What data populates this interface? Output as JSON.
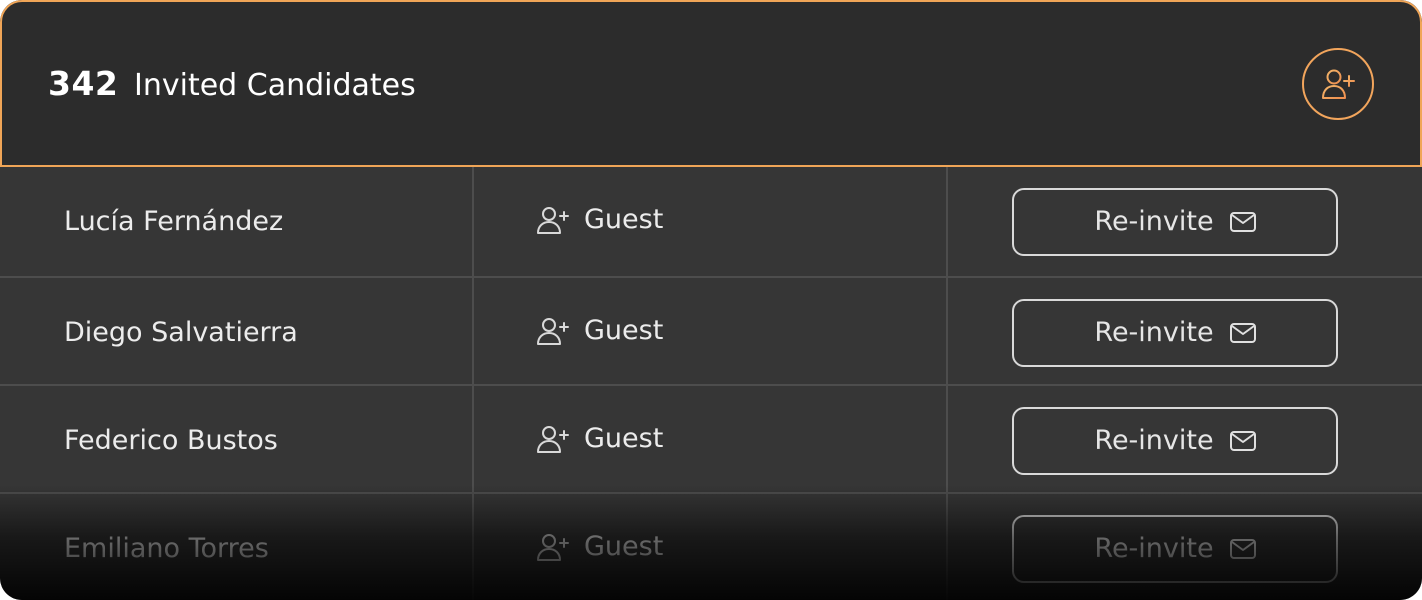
{
  "header": {
    "count": "342",
    "title": "Invited Candidates",
    "add_button_icon": "user-plus-icon"
  },
  "colors": {
    "accent": "#f0a557",
    "header_bg": "#2c2c2c",
    "row_bg": "#363636",
    "text": "#ececec"
  },
  "candidates": [
    {
      "name": "Lucía Fernández",
      "role": "Guest",
      "action": "Re-invite"
    },
    {
      "name": "Diego Salvatierra",
      "role": "Guest",
      "action": "Re-invite"
    },
    {
      "name": "Federico Bustos",
      "role": "Guest",
      "action": "Re-invite"
    },
    {
      "name": "Emiliano Torres",
      "role": "Guest",
      "action": "Re-invite"
    }
  ],
  "icons": {
    "role": "user-plus-icon",
    "action": "mail-icon"
  }
}
